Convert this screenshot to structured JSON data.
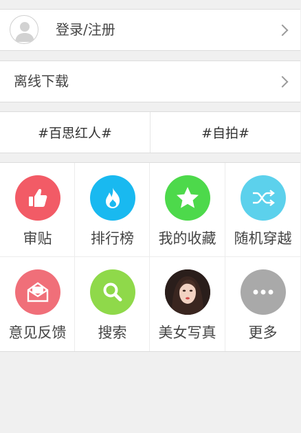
{
  "account": {
    "login_label": "登录/注册"
  },
  "offline": {
    "label": "离线下载"
  },
  "tags": [
    {
      "label": "#百思红人#"
    },
    {
      "label": "#自拍#"
    }
  ],
  "grid": {
    "items": [
      {
        "label": "审贴",
        "icon": "thumbs-up-icon",
        "color": "#f25b66"
      },
      {
        "label": "排行榜",
        "icon": "flame-icon",
        "color": "#19b9f0"
      },
      {
        "label": "我的收藏",
        "icon": "star-icon",
        "color": "#4dd94b"
      },
      {
        "label": "随机穿越",
        "icon": "shuffle-icon",
        "color": "#5cd1ec"
      },
      {
        "label": "意见反馈",
        "icon": "envelope-icon",
        "color": "#f06f79"
      },
      {
        "label": "搜索",
        "icon": "search-icon",
        "color": "#8fd94a"
      },
      {
        "label": "美女写真",
        "icon": "portrait-photo",
        "color": "#2a1e1b"
      },
      {
        "label": "更多",
        "icon": "more-dots-icon",
        "color": "#a9a9a9"
      }
    ]
  }
}
